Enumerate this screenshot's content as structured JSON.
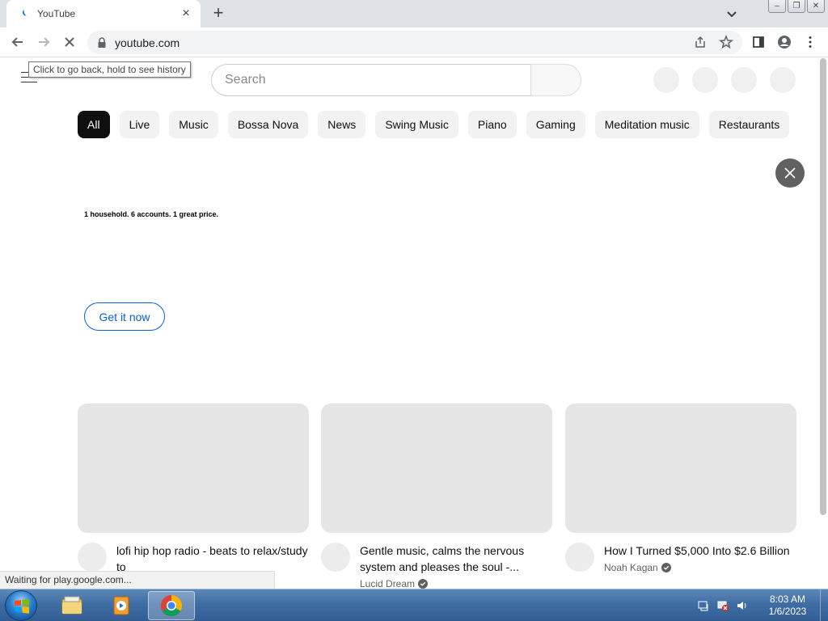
{
  "browser": {
    "tab": {
      "title": "YouTube"
    },
    "url": "youtube.com",
    "tooltip": "Click to go back, hold to see history",
    "status": "Waiting for play.google.com..."
  },
  "youtube": {
    "search_placeholder": "Search",
    "chips": [
      "All",
      "Live",
      "Music",
      "Bossa Nova",
      "News",
      "Swing Music",
      "Piano",
      "Gaming",
      "Meditation music",
      "Restaurants"
    ],
    "banner": {
      "tagline": "1 household. 6 accounts. 1 great price.",
      "cta": "Get it now"
    },
    "videos": [
      {
        "title": "lofi hip hop radio - beats to relax/study to",
        "channel": ""
      },
      {
        "title": "Gentle music, calms the nervous system and pleases the soul -...",
        "channel": "Lucid Dream"
      },
      {
        "title": "How I Turned $5,000 Into $2.6 Billion",
        "channel": "Noah Kagan"
      }
    ]
  },
  "taskbar": {
    "time": "8:03 AM",
    "date": "1/6/2023"
  },
  "colors": {
    "tabstrip": "#dee1e6",
    "chip_active": "#0f0f0f",
    "cta_blue": "#065fd4",
    "taskbar": "#3f6ea5"
  }
}
